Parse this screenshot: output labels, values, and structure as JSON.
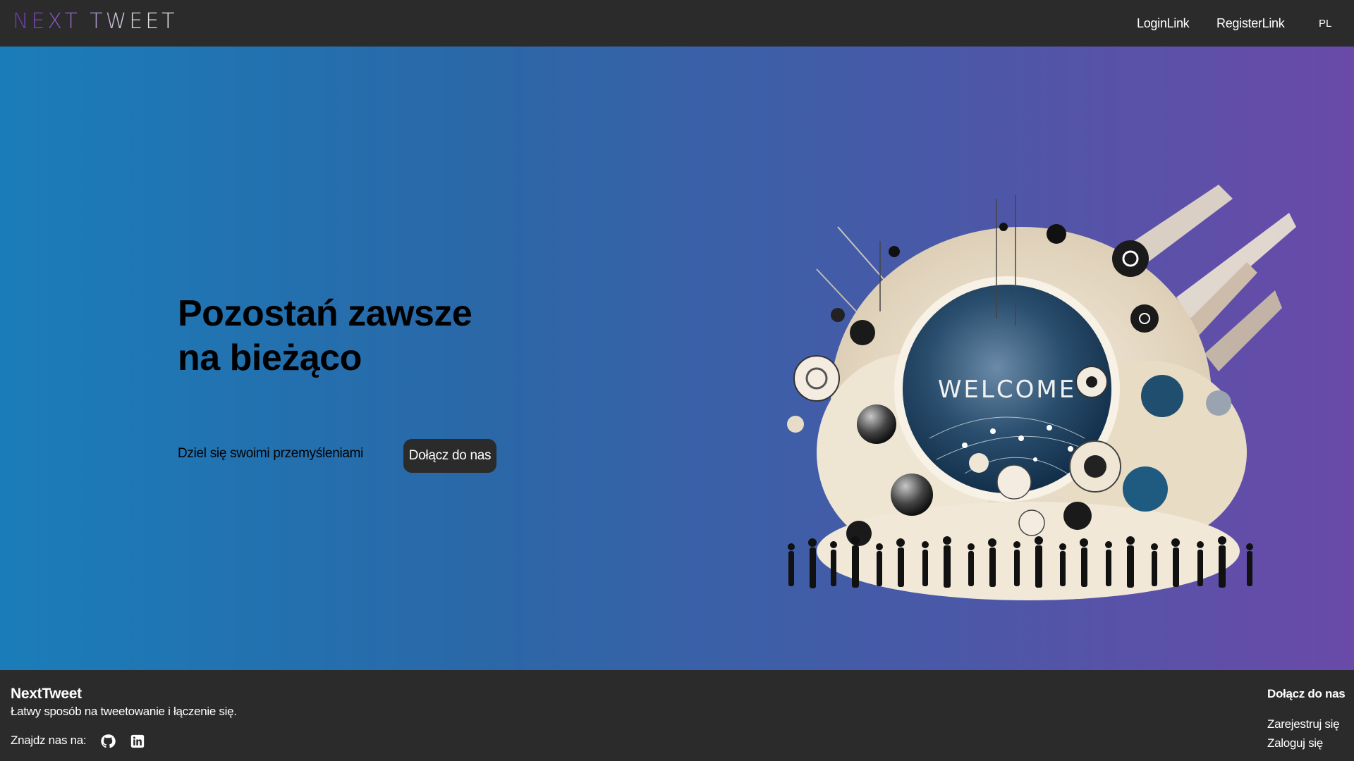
{
  "header": {
    "logo": "NEXT TWEET",
    "nav": {
      "login": "LoginLink",
      "register": "RegisterLink",
      "language": "PL"
    }
  },
  "hero": {
    "title_line1": "Pozostań zawsze",
    "title_line2": "na bieżąco",
    "subtitle": "Dziel się swoimi przemyśleniami",
    "join_button": "Dołącz do nas",
    "illustration_text": "WELCOME"
  },
  "footer": {
    "brand": "NextTweet",
    "tagline": "Łatwy sposób na tweetowanie i łączenie się.",
    "find_us": "Znajdz nas na:",
    "social_icons": [
      "github-icon",
      "linkedin-icon"
    ],
    "join_heading": "Dołącz do nas",
    "register_link": "Zarejestruj się",
    "login_link": "Zaloguj się"
  },
  "colors": {
    "header_bg": "#2b2b2b",
    "hero_gradient_start": "#1a7db9",
    "hero_gradient_end": "#6a4aa8",
    "button_bg": "#2b2b2b"
  }
}
